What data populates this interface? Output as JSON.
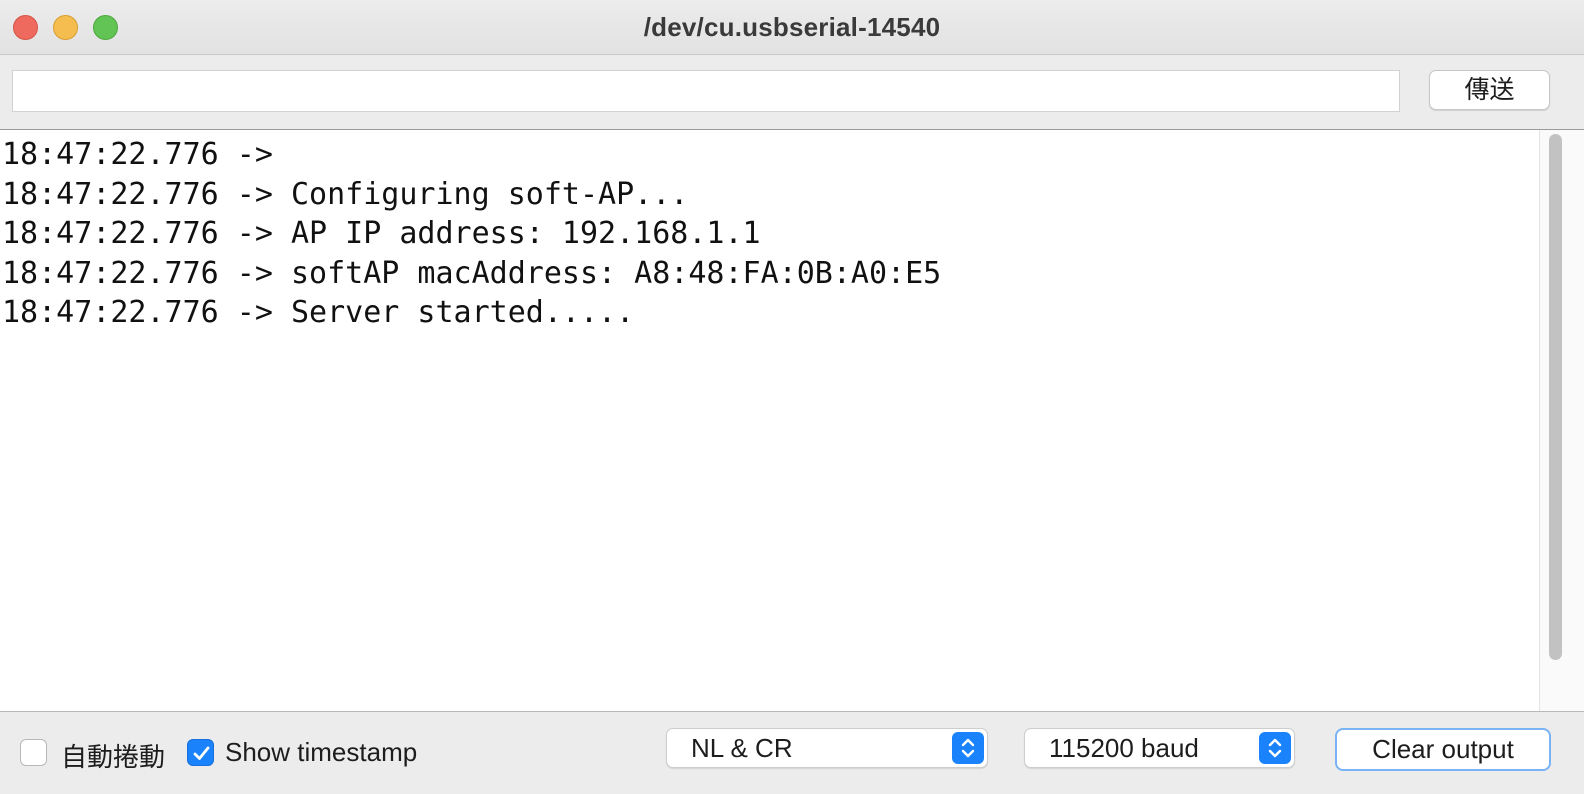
{
  "window": {
    "title": "/dev/cu.usbserial-14540"
  },
  "send": {
    "input_value": "",
    "button_label": "傳送"
  },
  "output": {
    "lines": [
      "18:47:22.776 -> ",
      "18:47:22.776 -> Configuring soft-AP...",
      "18:47:22.776 -> AP IP address: 192.168.1.1",
      "18:47:22.776 -> softAP macAddress: A8:48:FA:0B:A0:E5",
      "18:47:22.776 -> Server started....."
    ]
  },
  "footer": {
    "autoscroll": {
      "label": "自動捲動",
      "checked": false
    },
    "timestamp": {
      "label": "Show timestamp",
      "checked": true
    },
    "line_ending": {
      "selected": "NL & CR"
    },
    "baud_rate": {
      "selected": "115200 baud"
    },
    "clear_label": "Clear output"
  },
  "colors": {
    "accent": "#1a82fb",
    "close": "#ee6a5f",
    "minimize": "#f5bd4f",
    "maximize": "#61c454"
  }
}
